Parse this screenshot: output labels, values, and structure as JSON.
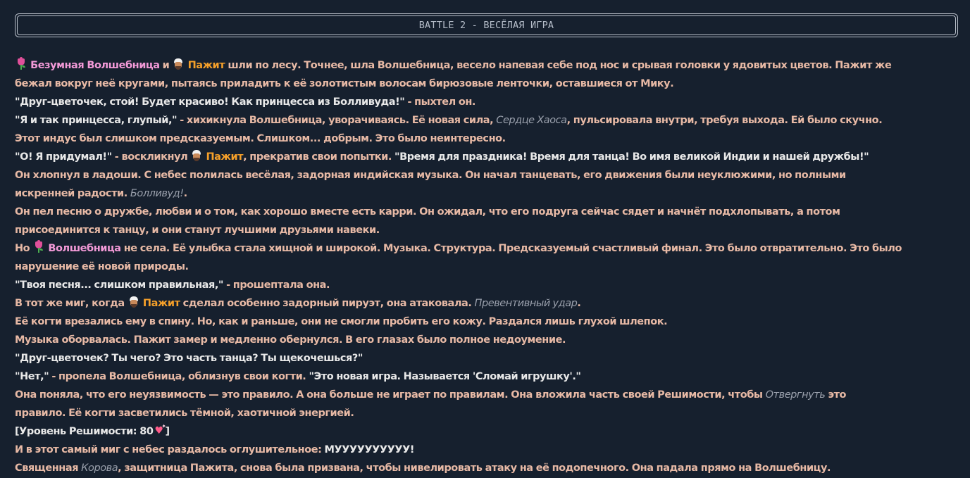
{
  "header": {
    "title": "BATTLE 2 - ВЕСЁЛАЯ ИГРА"
  },
  "names": {
    "wizard_full": "Безумная Волшебница",
    "wizard": "Волшебница",
    "pajit": "Пажит"
  },
  "icons": {
    "wizard": "tulip-icon",
    "pajit": "man-with-turban-icon",
    "resolve": "sparkling-heart-icon"
  },
  "colors": {
    "background": "#16202e",
    "narration": "#e7b9a5",
    "dialogue": "#e8e8e8",
    "wizard_name": "#f39ad8",
    "pajit_name": "#f5a02a",
    "ability": "#9aa0ac"
  },
  "story": {
    "l1": {
      "and": " и ",
      "rest": " шли по лесу. Точнее, шла Волшебница, весело напевая себе под нос и срывая головки у ядовитых цветов. Пажит же"
    },
    "l2": "бежал вокруг неё кругами, пытаясь приладить к её золотистым волосам бирюзовые ленточки, оставшиеся от Мику.",
    "l3": {
      "quote": "\"Друг-цветочек, стой! Будет красиво! Как принцесса из Болливуда!\"",
      "tail": " - пыхтел он."
    },
    "l4": {
      "quote": "\"Я и так принцесса, глупый,\"",
      "mid": " - хихикнула Волшебница, уворачиваясь. Её новая сила, ",
      "ability": "Сердце Хаоса",
      "tail": ", пульсировала внутри, требуя выхода. Ей было скучно."
    },
    "l5": "Этот индус был слишком предсказуемым. Слишком... добрым. Это было неинтересно.",
    "l6": {
      "quote": "\"О! Я придумал!\"",
      "mid": " - воскликнул ",
      "tail": ", прекратив свои попытки. ",
      "quote2": "\"Время для праздника! Время для танца! Во имя великой Индии и нашей дружбы!\""
    },
    "l7": "Он хлопнул в ладоши. С небес полилась весёлая, задорная индийская музыка. Он начал танцевать, его движения были неуклюжими, но полными",
    "l8": {
      "text": "искренней радости. ",
      "ability": "Болливуд!",
      "tail": "."
    },
    "l9": "Он пел песню о дружбе, любви и о том, как хорошо вместе есть карри. Он ожидал, что его подруга сейчас сядет и начнёт подхлопывать, а потом",
    "l10": "присоединится к танцу, и они станут лучшими друзьями навеки.",
    "l11": {
      "head": "Но ",
      "tail": " не села. Её улыбка стала хищной и широкой. Музыка. Структура. Предсказуемый счастливый финал. Это было отвратительно. Это было"
    },
    "l12": "нарушение её новой природы.",
    "l13": {
      "quote": "\"Твоя песня... слишком правильная,\"",
      "tail": " - прошептала она."
    },
    "l14": {
      "head": "В тот же миг, когда ",
      "mid": " сделал особенно задорный пируэт, она атаковала. ",
      "ability": "Превентивный удар",
      "tail": "."
    },
    "l15": "Её когти врезались ему в спину. Но, как и раньше, они не смогли пробить его кожу. Раздался лишь глухой шлепок.",
    "l16": "Музыка оборвалась. Пажит замер и медленно обернулся. В его глазах было полное недоумение.",
    "l17": "\"Друг-цветочек? Ты чего? Это часть танца? Ты щекочешься?\"",
    "l18": {
      "quote": "\"Нет,\"",
      "mid": " - пропела Волшебница, облизнув свои когти. ",
      "quote2": "\"Это новая игра. Называется 'Сломай игрушку'.\""
    },
    "l19": {
      "text": "Она поняла, что его неуязвимость — это правило. А она больше не играет по правилам. Она вложила часть своей Решимости, чтобы ",
      "ability": "Отвергнуть",
      "tail": " это"
    },
    "l20": "правило. Её когти засветились тёмной, хаотичной энергией.",
    "l21": {
      "head": "[Уровень Решимости: 80",
      "tail": "]"
    },
    "l22": {
      "head": "И в этот самый миг с небес раздалось оглушительное: ",
      "shout": "МУУУУУУУУУУ!"
    },
    "l23": {
      "head": "Священная ",
      "ability": "Корова",
      "tail": ", защитница Пажита, снова была призвана, чтобы нивелировать атаку на её подопечного. Она падала прямо на Волшебницу."
    }
  }
}
